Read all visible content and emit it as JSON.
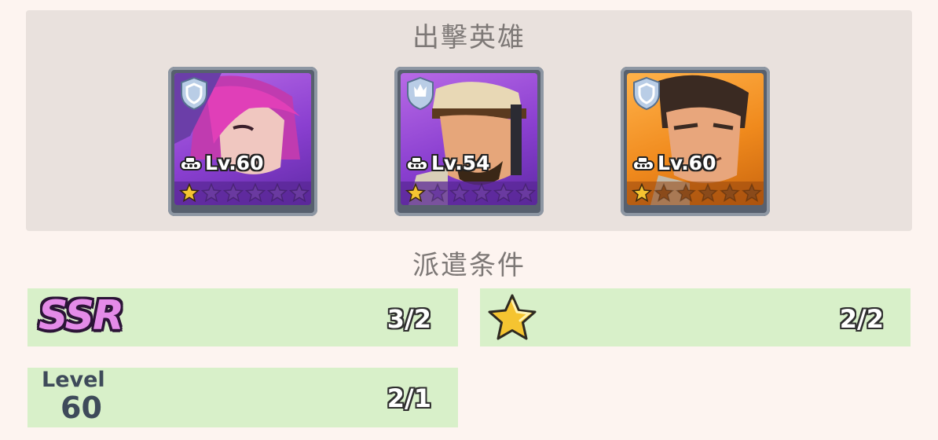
{
  "deploy_section": {
    "title": "出擊英雄"
  },
  "heroes": [
    {
      "level_text": "Lv.60",
      "stars_filled": 1,
      "stars_total": 6,
      "frame": "purple",
      "badge": "shield-icon"
    },
    {
      "level_text": "Lv.54",
      "stars_filled": 1,
      "stars_total": 6,
      "frame": "purple",
      "badge": "flame-shield-icon"
    },
    {
      "level_text": "Lv.60",
      "stars_filled": 1,
      "stars_total": 6,
      "frame": "orange",
      "badge": "shield-icon"
    }
  ],
  "conditions_section": {
    "title": "派遣条件"
  },
  "conditions": {
    "ssr": {
      "label": "SSR",
      "value": "3/2"
    },
    "star": {
      "icon": "star-icon",
      "value": "2/2"
    },
    "level": {
      "label": "Level",
      "number": "60",
      "value": "2/1"
    }
  },
  "colors": {
    "background": "#fdf4f0",
    "panel": "#e9e1dd",
    "condition_bg": "#d8f0c9",
    "ssr_pink": "#e48be8",
    "star_gold": "#f5c431"
  }
}
